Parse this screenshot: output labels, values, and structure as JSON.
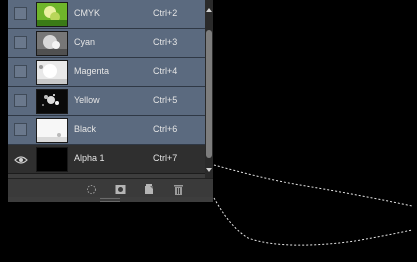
{
  "channels": [
    {
      "name": "CMYK",
      "shortcut": "Ctrl+2",
      "selected": true,
      "visible_icon": "empty-visibility-box"
    },
    {
      "name": "Cyan",
      "shortcut": "Ctrl+3",
      "selected": true,
      "visible_icon": "empty-visibility-box"
    },
    {
      "name": "Magenta",
      "shortcut": "Ctrl+4",
      "selected": true,
      "visible_icon": "empty-visibility-box"
    },
    {
      "name": "Yellow",
      "shortcut": "Ctrl+5",
      "selected": true,
      "visible_icon": "empty-visibility-box"
    },
    {
      "name": "Black",
      "shortcut": "Ctrl+6",
      "selected": true,
      "visible_icon": "empty-visibility-box"
    },
    {
      "name": "Alpha 1",
      "shortcut": "Ctrl+7",
      "selected": false,
      "visible_icon": "eye-icon"
    }
  ],
  "footer_icons": [
    "load-channel-as-selection-icon",
    "save-selection-as-channel-icon",
    "new-channel-icon",
    "delete-channel-icon"
  ],
  "colors": {
    "selected_row": "#5b6a7f",
    "unselected_row": "#2f2f2f",
    "panel_bg": "#3d3d3d",
    "canvas_bg": "#000000",
    "selection_edge": "#ffffff"
  }
}
